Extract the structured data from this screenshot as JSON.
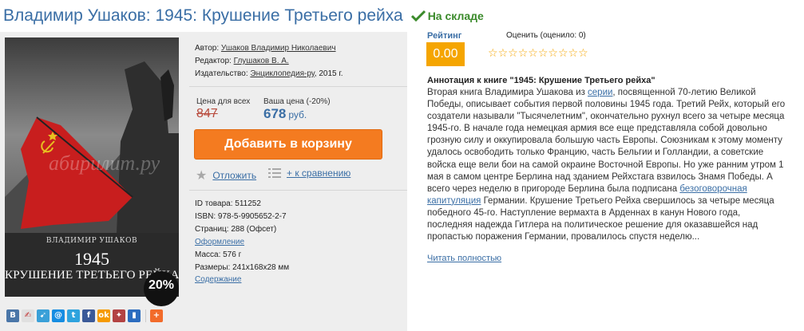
{
  "product": {
    "title": "Владимир Ушаков: 1945: Крушение Третьего рейха",
    "stock_status": "На складе"
  },
  "cover": {
    "author": "ВЛАДИМИР УШАКОВ",
    "year": "1945",
    "subtitle": "КРУШЕНИЕ ТРЕТЬЕГО РЕЙХА",
    "watermark": "абирилит.ру",
    "discount_badge": "20%"
  },
  "meta": {
    "author_label": "Автор:",
    "author": "Ушаков Владимир Николаевич",
    "editor_label": "Редактор:",
    "editor": "Глушаков В. А.",
    "publisher_label": "Издательство:",
    "publisher": "Энциклопедия-ру",
    "year": ", 2015 г."
  },
  "price": {
    "list_label": "Цена для всех",
    "your_label": "Ваша цена (-20%)",
    "old_price": "847",
    "new_price": "678",
    "currency": "руб."
  },
  "actions": {
    "add_to_cart": "Добавить в корзину",
    "postpone": "Отложить",
    "compare": "+ к сравнению"
  },
  "details": {
    "id_label": "ID товара:",
    "id": "511252",
    "isbn_label": "ISBN:",
    "isbn": "978-5-9905652-2-7",
    "pages_label": "Страниц:",
    "pages": "288 (Офсет)",
    "design_link": "Оформление",
    "weight_label": "Масса:",
    "weight": "576 г",
    "size_label": "Размеры:",
    "size": "241x168x28 мм",
    "contents_link": "Содержание"
  },
  "rating": {
    "label": "Рейтинг",
    "score": "0.00",
    "rate_label": "Оценить (оценило: 0)",
    "stars_total": 10
  },
  "annotation": {
    "title": "Аннотация к книге \"1945: Крушение Третьего рейха\"",
    "part1": "Вторая книга Владимира Ушакова из ",
    "link1": "серии",
    "part2": ", посвященной 70-летию Великой Победы, описывает события первой половины 1945 года. Третий Рейх, который его создатели называли \"Тысячелетним\", окончательно рухнул всего за четыре месяца 1945-го. В начале года немецкая армия все еще представляла собой довольно грозную силу и оккупировала большую часть Европы. Союзникам к этому моменту удалось освободить только Францию, часть Бельгии и Голландии, а советские войска еще вели бои на самой окраине Восточной Европы. Но уже ранним утром 1 мая в самом центре Берлина над зданием Рейхстага взвилось Знамя Победы. А всего через неделю в пригороде Берлина была подписана ",
    "link2": "безоговорочная капитуляция",
    "part3": " Германии. Крушение Третьего Рейха свершилось за четыре месяца победного 45-го. Наступление вермахта в Арденнах в канун Нового года, последняя надежда Гитлера на политическое решение для оказавшейся над пропастью поражения Германии, провалилось спустя неделю...",
    "read_more": "Читать полностью"
  },
  "social": {
    "icons": [
      {
        "name": "vk-icon",
        "glyph": "В",
        "color": "#4a76a8"
      },
      {
        "name": "livejournal-icon",
        "glyph": "✍",
        "color": "#e0e0e0"
      },
      {
        "name": "liveinternet-icon",
        "glyph": "➹",
        "color": "#3aa0d8"
      },
      {
        "name": "mail-icon",
        "glyph": "@",
        "color": "#168de2"
      },
      {
        "name": "twitter-icon",
        "glyph": "t",
        "color": "#2ea3de"
      },
      {
        "name": "facebook-icon",
        "glyph": "f",
        "color": "#3b5998"
      },
      {
        "name": "odnoklassniki-icon",
        "glyph": "ok",
        "color": "#f59a00"
      },
      {
        "name": "moimir-icon",
        "glyph": "✦",
        "color": "#b34343"
      },
      {
        "name": "bookmark-icon",
        "glyph": "▮",
        "color": "#2b6cbf"
      },
      {
        "name": "share-plus-icon",
        "glyph": "+",
        "color": "#f26b2a"
      }
    ]
  },
  "colors": {
    "accent_blue": "#3a6ea5",
    "button_orange": "#f47b20",
    "rating_orange": "#f5a500",
    "stock_green": "#3a8a2a",
    "old_price_red": "#b84a3c"
  }
}
